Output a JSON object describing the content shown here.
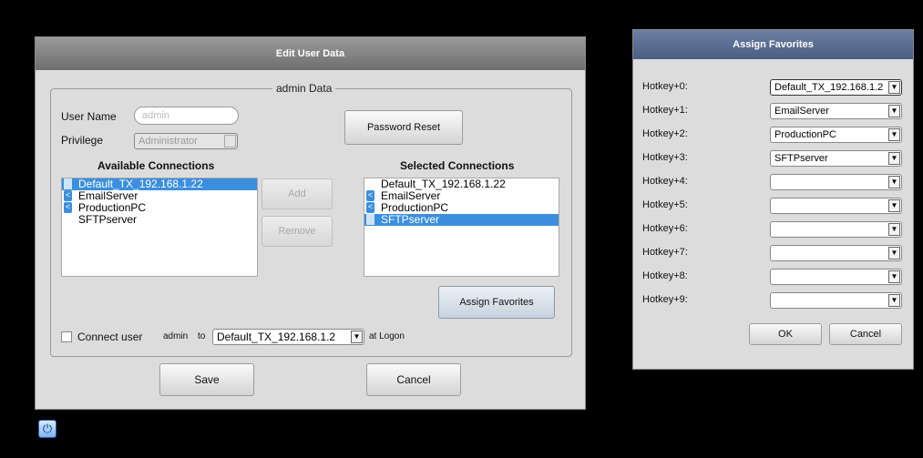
{
  "edit_dialog": {
    "title": "Edit User Data",
    "group_title": "admin Data",
    "user_name_label": "User Name",
    "user_name_value": "admin",
    "privilege_label": "Privilege",
    "privilege_value": "Administrator",
    "password_reset_label": "Password Reset",
    "available_header": "Available Connections",
    "selected_header": "Selected Connections",
    "available_items": [
      {
        "label": "Default_TX_192.168.1.22",
        "icon": "selected-marker",
        "selected": true
      },
      {
        "label": "EmailServer",
        "icon": "share-icon",
        "selected": false
      },
      {
        "label": "ProductionPC",
        "icon": "share-icon",
        "selected": false
      },
      {
        "label": "SFTPserver",
        "icon": "none",
        "selected": false
      }
    ],
    "selected_items": [
      {
        "label": "Default_TX_192.168.1.22",
        "icon": "none",
        "selected": false
      },
      {
        "label": "EmailServer",
        "icon": "share-icon",
        "selected": false
      },
      {
        "label": "ProductionPC",
        "icon": "share-icon",
        "selected": false
      },
      {
        "label": "SFTPserver",
        "icon": "selected-marker",
        "selected": true
      }
    ],
    "add_label": "Add",
    "remove_label": "Remove",
    "assign_favorites_label": "Assign Favorites",
    "connect_user_label": "Connect user",
    "connect_user_name": "admin",
    "connect_to_label": "to",
    "connect_target": "Default_TX_192.168.1.2",
    "at_logon_label": "at Logon",
    "save_label": "Save",
    "cancel_label": "Cancel"
  },
  "favorites_dialog": {
    "title": "Assign Favorites",
    "hotkeys": [
      {
        "label": "Hotkey+0:",
        "value": "Default_TX_192.168.1.2"
      },
      {
        "label": "Hotkey+1:",
        "value": "EmailServer"
      },
      {
        "label": "Hotkey+2:",
        "value": "ProductionPC"
      },
      {
        "label": "Hotkey+3:",
        "value": "SFTPserver"
      },
      {
        "label": "Hotkey+4:",
        "value": ""
      },
      {
        "label": "Hotkey+5:",
        "value": ""
      },
      {
        "label": "Hotkey+6:",
        "value": ""
      },
      {
        "label": "Hotkey+7:",
        "value": ""
      },
      {
        "label": "Hotkey+8:",
        "value": ""
      },
      {
        "label": "Hotkey+9:",
        "value": ""
      }
    ],
    "ok_label": "OK",
    "cancel_label": "Cancel"
  },
  "taskbar": {
    "power_icon": "power-icon"
  },
  "colors": {
    "selection": "#3b8fde",
    "title_gray": "#7a7a7a",
    "title_blue": "#5a6d92"
  }
}
